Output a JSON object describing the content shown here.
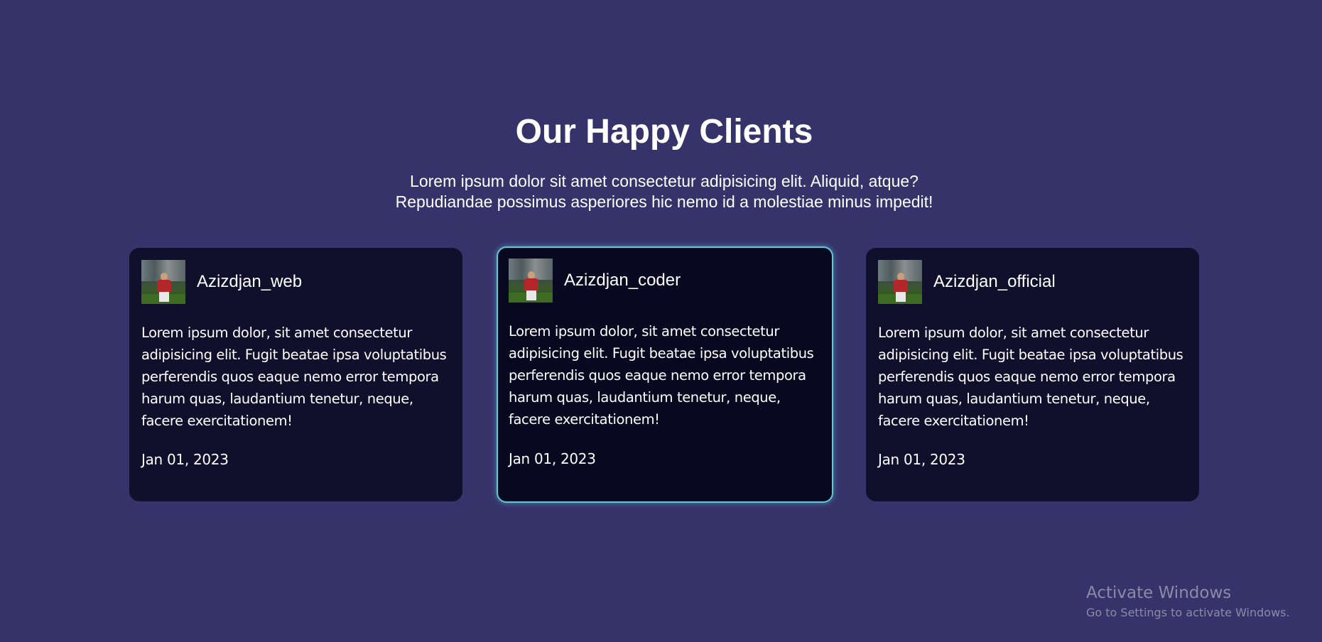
{
  "section": {
    "title": "Our Happy Clients",
    "subtitle_lines": [
      "Lorem ipsum dolor sit amet consectetur adipisicing elit. Aliquid, atque?",
      "Repudiandae possimus asperiores hic nemo id a molestiae minus impedit!"
    ]
  },
  "cards": [
    {
      "name": "Azizdjan_web",
      "text": "Lorem ipsum dolor, sit amet consectetur adipisicing elit. Fugit beatae ipsa voluptatibus perferendis quos eaque nemo error tempora harum quas, laudantium tenetur, neque, facere exercitationem!",
      "date": "Jan 01, 2023",
      "active": false
    },
    {
      "name": "Azizdjan_coder",
      "text": "Lorem ipsum dolor, sit amet consectetur adipisicing elit. Fugit beatae ipsa voluptatibus perferendis quos eaque nemo error tempora harum quas, laudantium tenetur, neque, facere exercitationem!",
      "date": "Jan 01, 2023",
      "active": true
    },
    {
      "name": "Azizdjan_official",
      "text": "Lorem ipsum dolor, sit amet consectetur adipisicing elit. Fugit beatae ipsa voluptatibus perferendis quos eaque nemo error tempora harum quas, laudantium tenetur, neque, facere exercitationem!",
      "date": "Jan 01, 2023",
      "active": false
    }
  ],
  "watermark": {
    "title": "Activate Windows",
    "subtitle": "Go to Settings to activate Windows."
  },
  "colors": {
    "background": "#36336b",
    "card": "#100f2c",
    "card_active": "#080821",
    "card_active_border": "#5fc8d4",
    "text": "#ffffff"
  }
}
